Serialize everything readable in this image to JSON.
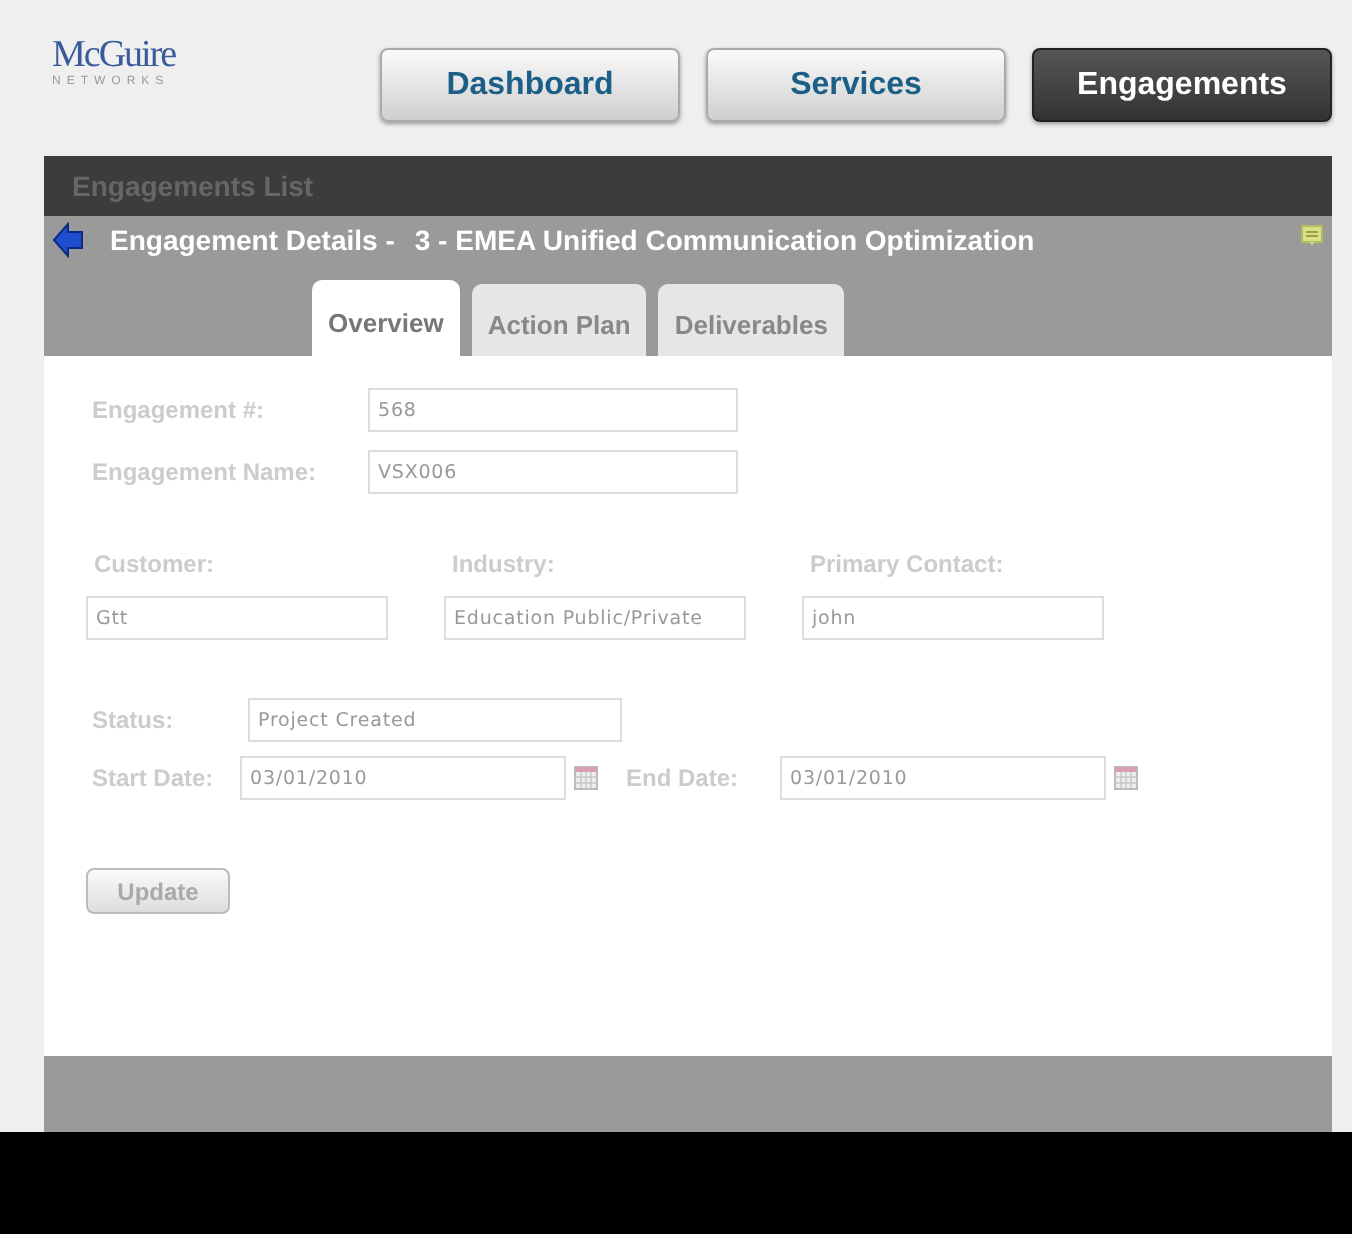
{
  "logo": {
    "name": "McGuire",
    "tagline": "NETWORKS"
  },
  "nav": [
    {
      "label": "Dashboard",
      "selected": false
    },
    {
      "label": "Services",
      "selected": false
    },
    {
      "label": "Engagements",
      "selected": true
    }
  ],
  "list_bar": {
    "title": "Engagements List"
  },
  "details": {
    "title": "Engagement Details -",
    "subject": "3 - EMEA Unified Communication Optimization"
  },
  "tabs": [
    {
      "label": "Overview",
      "selected": true
    },
    {
      "label": "Action Plan",
      "selected": false
    },
    {
      "label": "Deliverables",
      "selected": false
    }
  ],
  "form": {
    "disabled": true,
    "top_fields": [
      {
        "label": "Engagement #:",
        "value": "568"
      },
      {
        "label": "Engagement Name:",
        "value": "VSX006"
      }
    ],
    "columns": [
      {
        "label": "Customer:",
        "value": "Gtt"
      },
      {
        "label": "Industry:",
        "value": "Education Public/Private"
      },
      {
        "label": "Primary Contact:",
        "value": "john"
      }
    ],
    "status": {
      "label": "Status:",
      "value": "Project Created"
    },
    "dates": [
      {
        "label": "Start Date:",
        "value": "03/01/2010"
      },
      {
        "label": "End Date:",
        "value": "03/01/2010"
      }
    ],
    "button": "Update"
  }
}
